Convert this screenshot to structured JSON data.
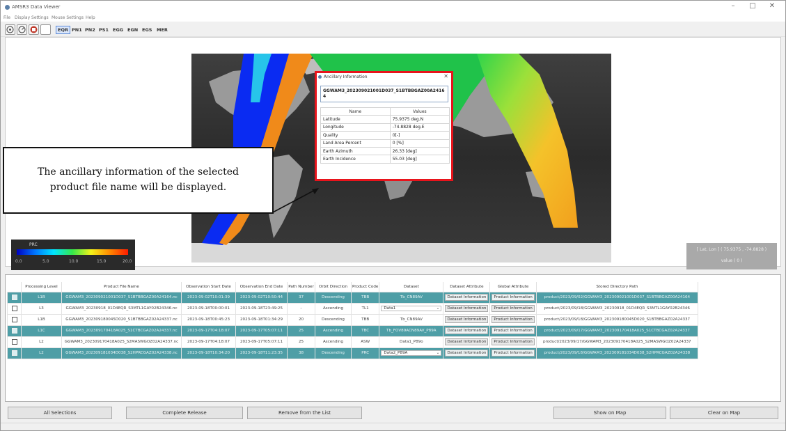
{
  "window": {
    "title": "AMSR3 Data Viewer",
    "min_label": "–",
    "max_label": "□",
    "close_label": "✕"
  },
  "menu": [
    "File",
    "Display Settings",
    "Mouse Settings",
    "Help"
  ],
  "toolbar": {
    "projections": [
      "EQR",
      "PN1",
      "PN2",
      "PS1",
      "EGG",
      "EGN",
      "EGS",
      "MER"
    ],
    "active_projection": "EQR",
    "icons": [
      "zoom-icon",
      "rotate-icon",
      "stop-icon",
      "blank-icon"
    ]
  },
  "ancillary": {
    "title": "Ancillary Information",
    "close": "✕",
    "file_name": "GGWAM3_202309021001D037_S1BTBBGAZ00A24164",
    "headers": [
      "Name",
      "Values"
    ],
    "rows": [
      {
        "name": "Latitude",
        "value": "75.9375 deg.N"
      },
      {
        "name": "Longitude",
        "value": "-74.8828 deg.E"
      },
      {
        "name": "Quality",
        "value": "0[-]"
      },
      {
        "name": "Land Area Percent",
        "value": "0 [%]"
      },
      {
        "name": "Earth Azimuth",
        "value": "26.33 [deg]"
      },
      {
        "name": "Earth Incidence",
        "value": "55.03 [deg]"
      }
    ]
  },
  "callout": {
    "line1": "The ancillary information of the selected",
    "line2": "product file name will be displayed."
  },
  "colorbar": {
    "label": "PRC",
    "ticks": [
      "0.0",
      "5.0",
      "10.0",
      "15.0",
      "20.0"
    ]
  },
  "coords": {
    "latlon": "[ Lat, Lon ] ( 75.9375 , -74.8828 )",
    "value": "value ( 0 )"
  },
  "table": {
    "headers": [
      "",
      "Processing Level",
      "Product File Name",
      "Observation Start Date",
      "Observation End Date",
      "Path Number",
      "Orbit Direction",
      "Product Code",
      "Dataset",
      "Dataset Attribute",
      "Global Attribute",
      "Stored Directory Path"
    ],
    "rows": [
      {
        "selected": true,
        "level": "L1B",
        "file": "GGWAM3_202309021001D037_S1BTBBGAZ00A24164.nc",
        "start": "2023-09-02T10:01:39",
        "end": "2023-09-02T10:50:44",
        "path": "37",
        "orbit": "Descending",
        "code": "TBB",
        "dataset": "Tb_CN89AV",
        "dataset_dropdown": false,
        "ds_attr": "Dataset Information",
        "gl_attr": "Product Information",
        "dir": "product/2023/09/02/GGWAM3_202309021001D037_S1BTBBGAZ00A24164"
      },
      {
        "selected": false,
        "level": "L3",
        "file": "GGWAM3_20230918_01D4EQR_S3MTL1GAY02B24346.nc",
        "start": "2023-09-18T00:00:01",
        "end": "2023-09-18T23:49:25",
        "path": "-",
        "orbit": "Ascending",
        "code": "TL1",
        "dataset": "Data1",
        "dataset_dropdown": true,
        "ds_attr": "Dataset Information",
        "gl_attr": "Product Information",
        "dir": "product/2023/09/18/GGWAM3_20230918_01D4EQR_S3MTL1GAY02B24346"
      },
      {
        "selected": false,
        "level": "L1B",
        "file": "GGWAM3_202309180045D020_S1BTBBGAZ02A24337.nc",
        "start": "2023-09-18T00:45:23",
        "end": "2023-09-18T01:34:29",
        "path": "20",
        "orbit": "Descending",
        "code": "TBB",
        "dataset": "Tb_CN89AV",
        "dataset_dropdown": false,
        "ds_attr": "Dataset Information",
        "gl_attr": "Product Information",
        "dir": "product/2023/09/18/GGWAM3_202309180045D020_S1BTBBGAZ02A24337"
      },
      {
        "selected": true,
        "level": "L1C",
        "file": "GGWAM3_202309170418A025_S1CTBCGAZ02A24337.nc",
        "start": "2023-09-17T04:18:07",
        "end": "2023-09-17T05:07:11",
        "path": "25",
        "orbit": "Ascending",
        "code": "TBC",
        "dataset": "Tb_FOV89ACN89AV_P89A",
        "dataset_dropdown": false,
        "ds_attr": "Dataset Information",
        "gl_attr": "Product Information",
        "dir": "product/2023/09/17/GGWAM3_202309170418A025_S1CTBCGAZ02A24337"
      },
      {
        "selected": false,
        "level": "L2",
        "file": "GGWAM3_202309170418A025_S2MASWGOZ02A24337.nc",
        "start": "2023-09-17T04:18:07",
        "end": "2023-09-17T05:07:11",
        "path": "25",
        "orbit": "Ascending",
        "code": "ASW",
        "dataset": "Data1_P89o",
        "dataset_dropdown": false,
        "ds_attr": "Dataset Information",
        "gl_attr": "Product Information",
        "dir": "product/2023/09/17/GGWAM3_202309170418A025_S2MASWGOZ02A24337"
      },
      {
        "selected": true,
        "level": "L2",
        "file": "GGWAM3_202309181034D038_S2HPRCGAZ02A24338.nc",
        "start": "2023-09-18T10:34:20",
        "end": "2023-09-18T11:23:35",
        "path": "38",
        "orbit": "Descending",
        "code": "PRC",
        "dataset": "Data2_P89A",
        "dataset_dropdown": true,
        "ds_attr": "Dataset Information",
        "gl_attr": "Product Information",
        "dir": "product/2023/09/18/GGWAM3_202309181034D038_S2HPRCGAZ02A24338"
      }
    ]
  },
  "buttons": {
    "all_selections": "All Selections",
    "complete_release": "Complete Release",
    "remove": "Remove from the List",
    "show_on_map": "Show on Map",
    "clear_on_map": "Clear on Map"
  },
  "colors": {
    "selected_row": "#4e9ea6",
    "dialog_border": "#e8141c"
  }
}
